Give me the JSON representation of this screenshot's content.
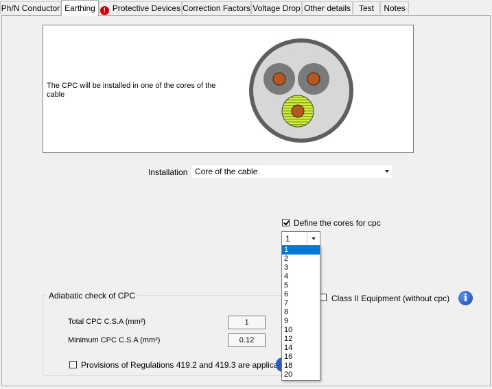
{
  "tabs": [
    {
      "label": "Ph/N Conductor",
      "active": false,
      "warning": false
    },
    {
      "label": "Earthing",
      "active": true,
      "warning": false
    },
    {
      "label": "Protective Devices",
      "active": false,
      "warning": true
    },
    {
      "label": "Correction Factors",
      "active": false,
      "warning": false
    },
    {
      "label": "Voltage Drop",
      "active": false,
      "warning": false
    },
    {
      "label": "Other details",
      "active": false,
      "warning": false
    },
    {
      "label": "Test",
      "active": false,
      "warning": false
    },
    {
      "label": "Notes",
      "active": false,
      "warning": false
    }
  ],
  "preview": {
    "description": "The CPC will be installed in one of the cores of the cable"
  },
  "installation": {
    "label": "Installation",
    "value": "Core of the cable"
  },
  "define_cores": {
    "label": "Define the cores for cpc",
    "checked": true,
    "selected": "1",
    "options": [
      "1",
      "2",
      "3",
      "4",
      "5",
      "6",
      "7",
      "8",
      "9",
      "10",
      "12",
      "14",
      "16",
      "18",
      "20"
    ]
  },
  "class2": {
    "label": "Class II Equipment (without cpc)",
    "checked": false
  },
  "adiabatic": {
    "title": "Adiabatic check of CPC",
    "total_label": "Total CPC C.S.A (mm²)",
    "total_value": "1",
    "min_label": "Minimum CPC C.S.A (mm²)",
    "min_value": "0.12",
    "provisions_label": "Provisions of Regulations 419.2 and 419.3 are applicable",
    "provisions_checked": false
  },
  "colors": {
    "accent": "#0078d7",
    "warning": "#d40000",
    "cable_sheath": "#5f5f5f",
    "core_copper": "#b5581f",
    "earth_core": "#d4ec3a"
  },
  "icons": {
    "warning": "exclamation-circle-icon",
    "info": "info-icon"
  }
}
